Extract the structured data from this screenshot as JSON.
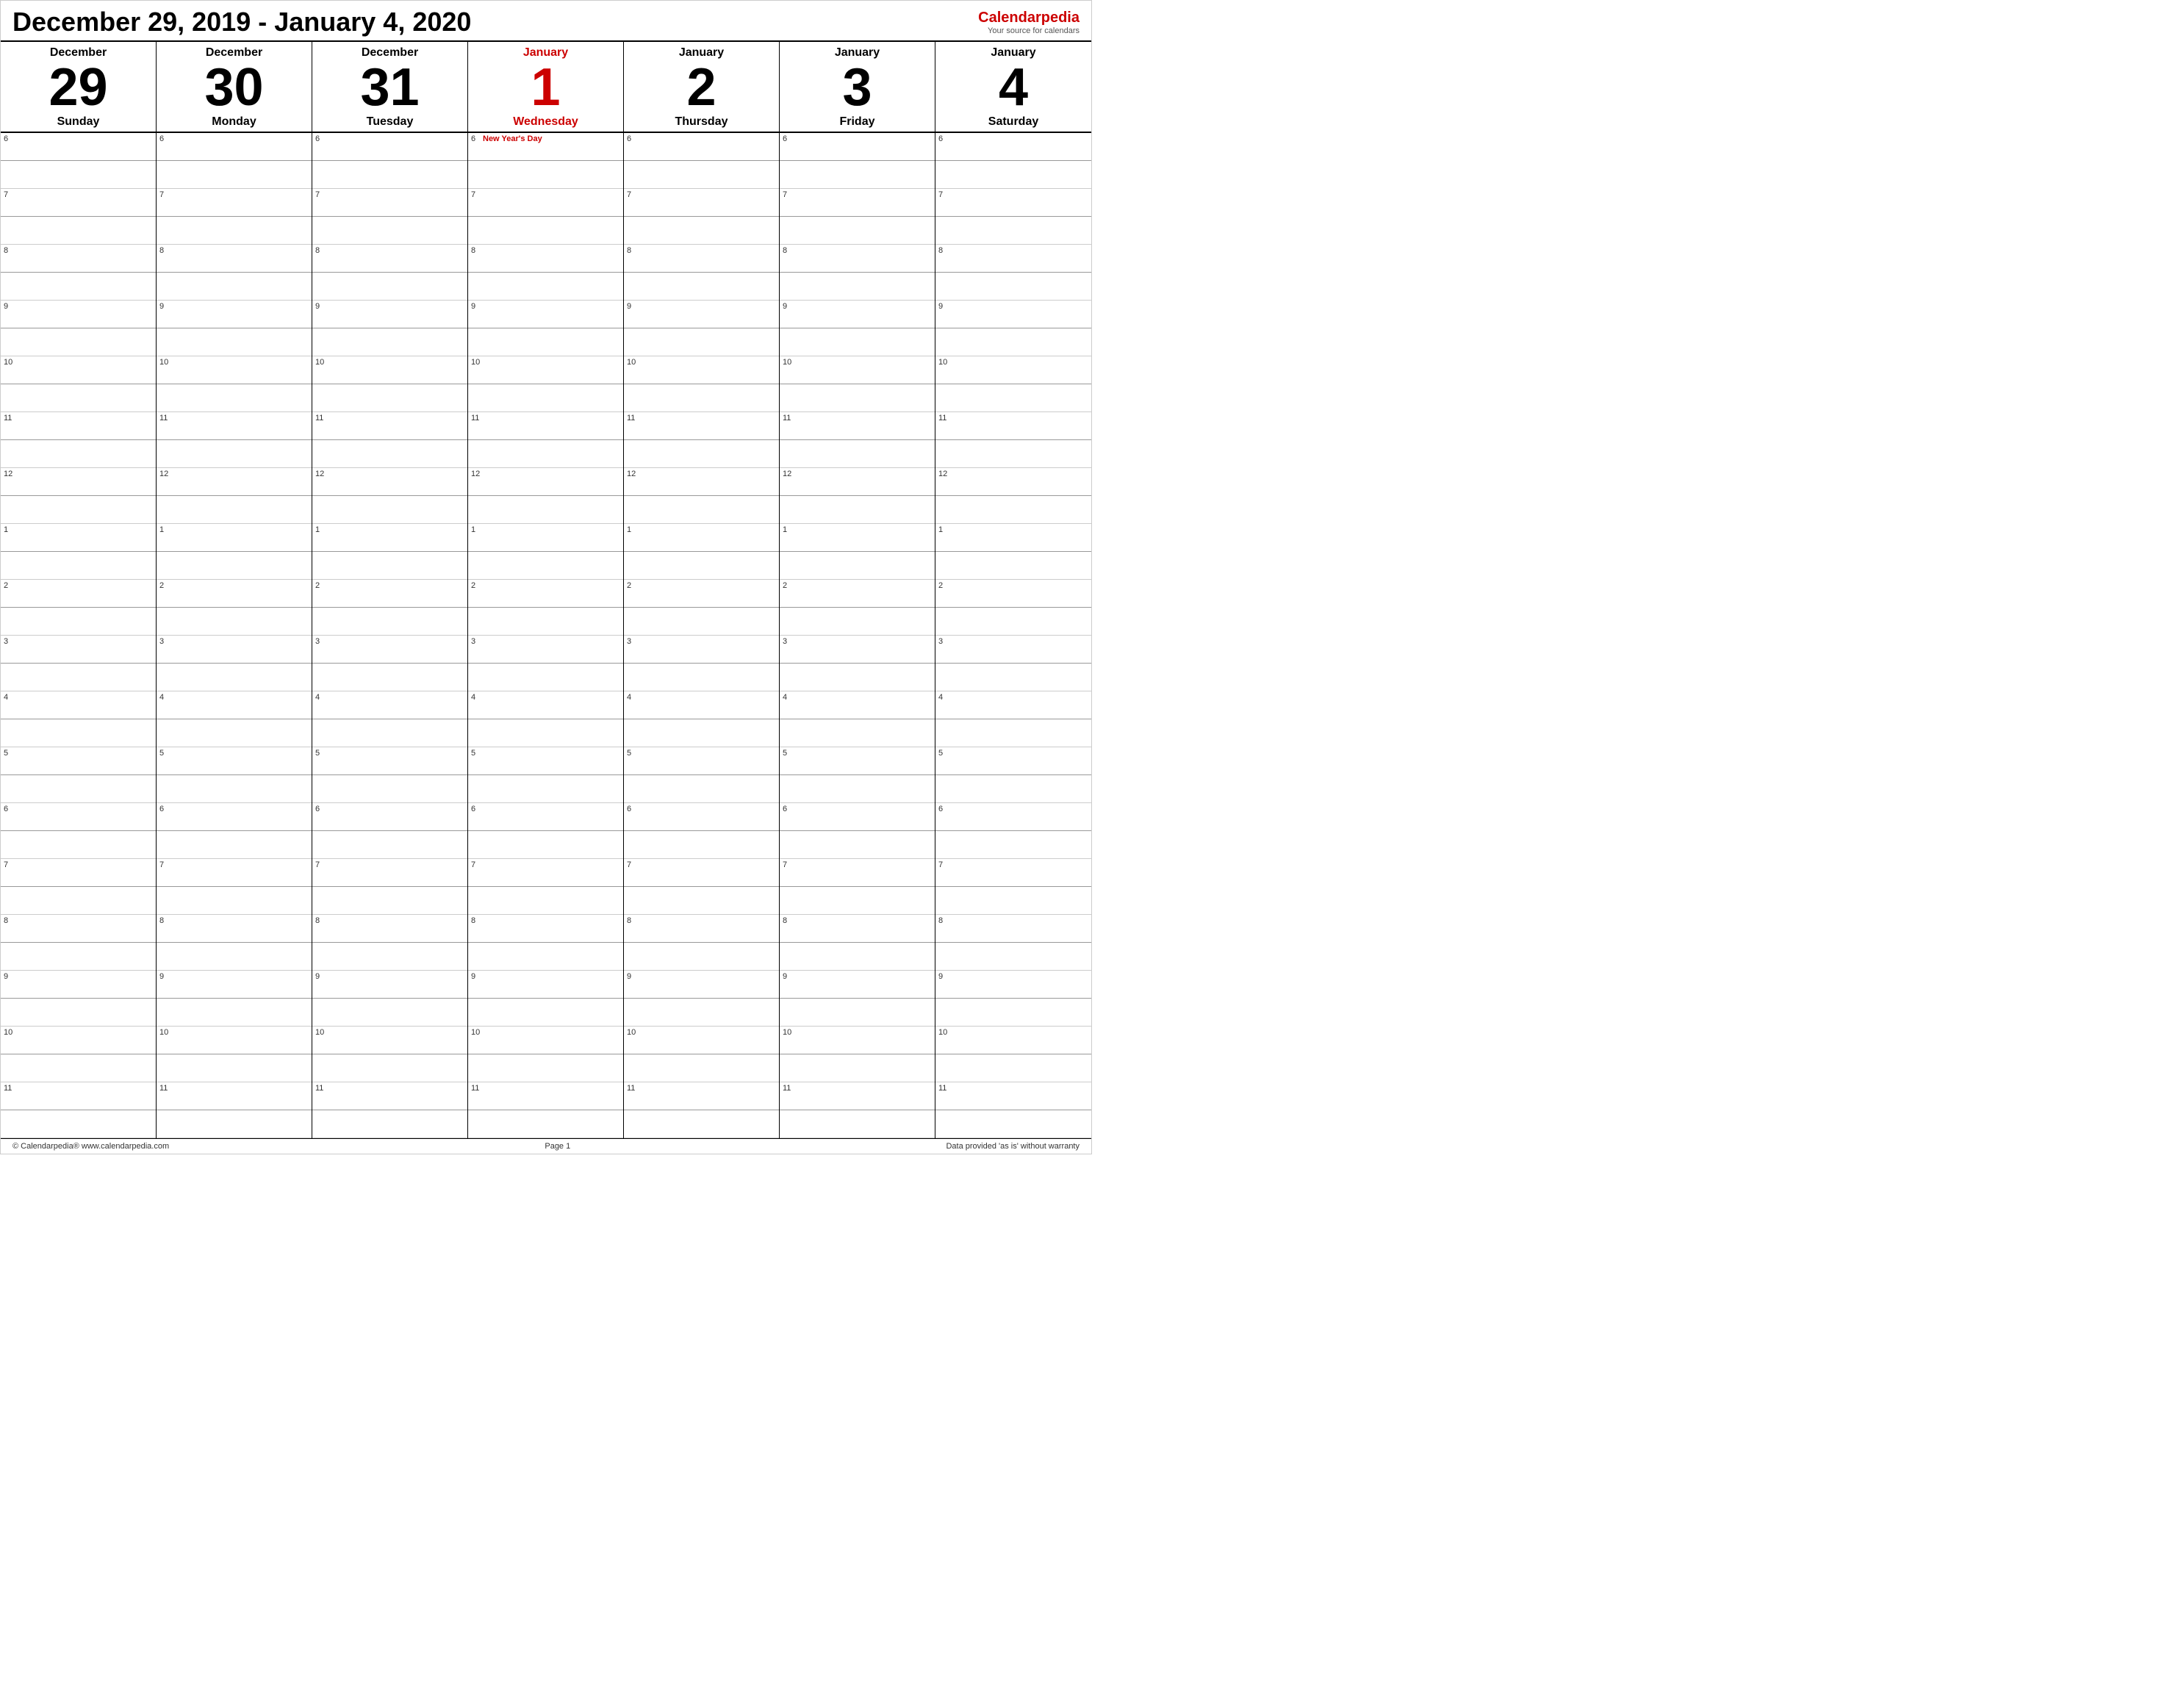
{
  "header": {
    "title": "December 29, 2019 - January 4, 2020",
    "logo_brand": "Calendar",
    "logo_brand_accent": "pedia",
    "logo_tagline": "Your source for calendars"
  },
  "days": [
    {
      "month": "December",
      "number": "29",
      "name": "Sunday",
      "today": false,
      "event": null
    },
    {
      "month": "December",
      "number": "30",
      "name": "Monday",
      "today": false,
      "event": null
    },
    {
      "month": "December",
      "number": "31",
      "name": "Tuesday",
      "today": false,
      "event": null
    },
    {
      "month": "January",
      "number": "1",
      "name": "Wednesday",
      "today": true,
      "event": "New Year's Day"
    },
    {
      "month": "January",
      "number": "2",
      "name": "Thursday",
      "today": false,
      "event": null
    },
    {
      "month": "January",
      "number": "3",
      "name": "Friday",
      "today": false,
      "event": null
    },
    {
      "month": "January",
      "number": "4",
      "name": "Saturday",
      "today": false,
      "event": null
    }
  ],
  "time_slots": [
    {
      "hour": "6",
      "half": false
    },
    {
      "hour": "",
      "half": true
    },
    {
      "hour": "7",
      "half": false
    },
    {
      "hour": "",
      "half": true
    },
    {
      "hour": "8",
      "half": false
    },
    {
      "hour": "",
      "half": true
    },
    {
      "hour": "9",
      "half": false
    },
    {
      "hour": "",
      "half": true
    },
    {
      "hour": "10",
      "half": false
    },
    {
      "hour": "",
      "half": true
    },
    {
      "hour": "11",
      "half": false
    },
    {
      "hour": "",
      "half": true
    },
    {
      "hour": "12",
      "half": false
    },
    {
      "hour": "",
      "half": true
    },
    {
      "hour": "1",
      "half": false
    },
    {
      "hour": "",
      "half": true
    },
    {
      "hour": "2",
      "half": false
    },
    {
      "hour": "",
      "half": true
    },
    {
      "hour": "3",
      "half": false
    },
    {
      "hour": "",
      "half": true
    },
    {
      "hour": "4",
      "half": false
    },
    {
      "hour": "",
      "half": true
    },
    {
      "hour": "5",
      "half": false
    },
    {
      "hour": "",
      "half": true
    },
    {
      "hour": "6",
      "half": false
    },
    {
      "hour": "",
      "half": true
    },
    {
      "hour": "7",
      "half": false
    },
    {
      "hour": "",
      "half": true
    },
    {
      "hour": "8",
      "half": false
    },
    {
      "hour": "",
      "half": true
    },
    {
      "hour": "9",
      "half": false
    },
    {
      "hour": "",
      "half": true
    },
    {
      "hour": "10",
      "half": false
    },
    {
      "hour": "",
      "half": true
    },
    {
      "hour": "11",
      "half": false
    },
    {
      "hour": "",
      "half": true
    }
  ],
  "footer": {
    "left": "© Calendarpedia®  www.calendarpedia.com",
    "center": "Page 1",
    "right": "Data provided 'as is' without warranty"
  }
}
